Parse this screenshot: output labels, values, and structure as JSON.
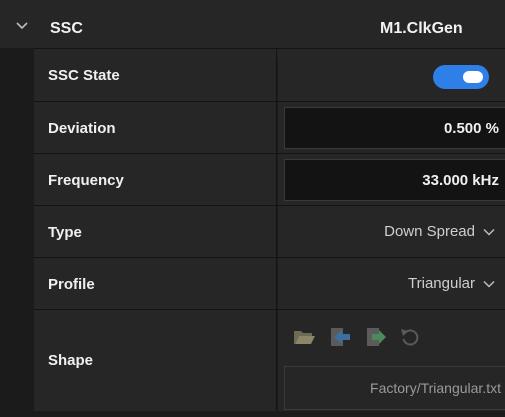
{
  "header": {
    "title": "SSC",
    "value": "M1.ClkGen",
    "icon": "chevron-down-icon"
  },
  "rows": {
    "ssc_state": {
      "label": "SSC State",
      "enabled": true
    },
    "deviation": {
      "label": "Deviation",
      "value": "0.500 %"
    },
    "frequency": {
      "label": "Frequency",
      "value": "33.000 kHz"
    },
    "type": {
      "label": "Type",
      "value": "Down Spread"
    },
    "profile": {
      "label": "Profile",
      "value": "Triangular"
    },
    "shape": {
      "label": "Shape",
      "file": "Factory/Triangular.txt",
      "tools": [
        "open-folder-icon",
        "import-icon",
        "export-icon",
        "reset-icon"
      ]
    }
  },
  "colors": {
    "accent": "#2f7fe8",
    "background": "#1b1b1b",
    "row": "#262626",
    "input": "#131313"
  }
}
